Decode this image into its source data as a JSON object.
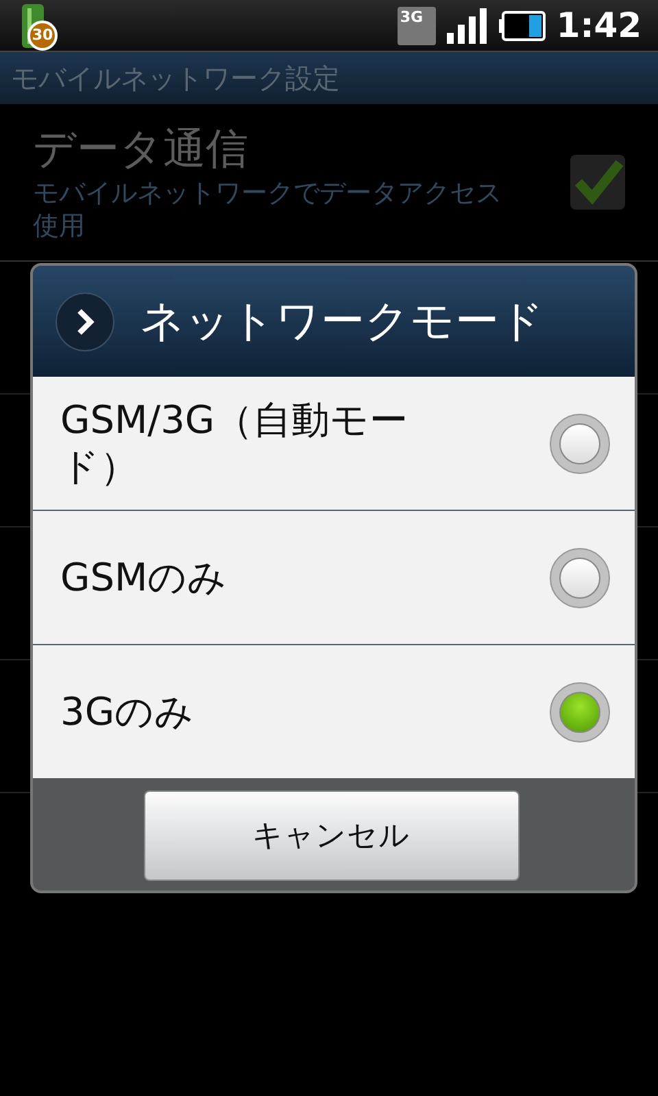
{
  "status_bar": {
    "notification_badge": "30",
    "network": "3G",
    "time": "1:42"
  },
  "title_bar": {
    "title": "モバイルネットワーク設定"
  },
  "settings": [
    {
      "title": "データ通信",
      "summary": "モバイルネットワークでデータアクセス使用",
      "checked": true
    }
  ],
  "dialog": {
    "title": "ネットワークモード",
    "options": [
      {
        "label": "GSM/3G（自動モード）",
        "selected": false
      },
      {
        "label": "GSMのみ",
        "selected": false
      },
      {
        "label": "3Gのみ",
        "selected": true
      }
    ],
    "buttons": [
      "キャンセル"
    ]
  }
}
